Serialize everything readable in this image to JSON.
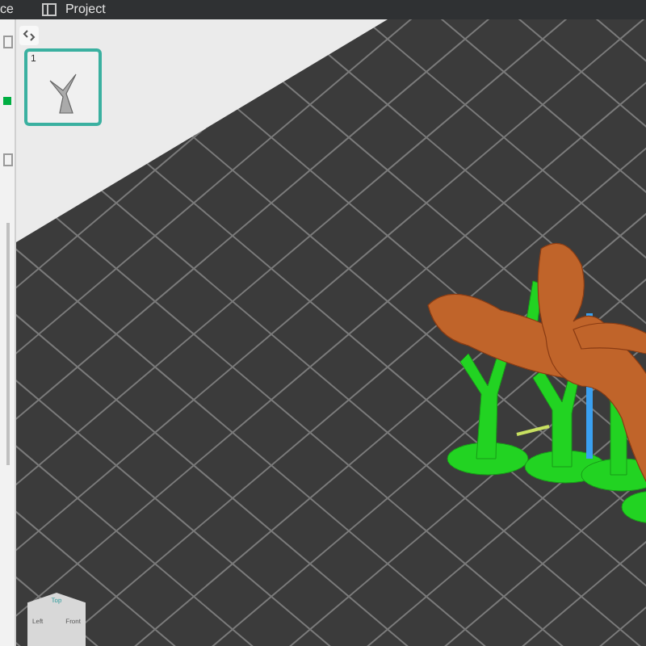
{
  "top_bar": {
    "tabs": [
      {
        "label": "ce",
        "selected": false
      },
      {
        "label": "Project",
        "selected": false
      }
    ]
  },
  "plate_list": {
    "plates": [
      {
        "number": "1",
        "selected": true
      }
    ]
  },
  "view_cube": {
    "faces": [
      "Top",
      "Left",
      "Front"
    ]
  }
}
